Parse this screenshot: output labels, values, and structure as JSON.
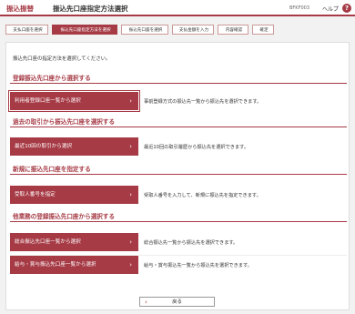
{
  "header": {
    "category": "振込振替",
    "title": "振込先口座指定方法選択",
    "screen_code": "BFKF003",
    "help_label": "ヘルプ",
    "help_icon": "?"
  },
  "steps": [
    "支払口座を選択",
    "振込先口座指定方法を選択",
    "振込先口座を選択",
    "支払金額を入力",
    "内容確認",
    "確定"
  ],
  "intro": "振込先口座の指定方法を選択してください。",
  "sections": [
    {
      "title": "登録振込先口座から選択する",
      "items": [
        {
          "label": "利用者登録口座一覧から選択",
          "desc": "事前登録方式の振込先一覧から振込先を選択できます。",
          "selected": true
        }
      ]
    },
    {
      "title": "過去の取引から振込先口座を選択する",
      "items": [
        {
          "label": "最近10回の取引から選択",
          "desc": "最近10回の取引履歴から振込先を選択できます。",
          "selected": false
        }
      ]
    },
    {
      "title": "新規に振込先口座を指定する",
      "items": [
        {
          "label": "受取人番号を指定",
          "desc": "受取人番号を入力して、新規に振込先を指定できます。",
          "selected": false
        }
      ]
    },
    {
      "title": "他業務の登録振込先口座から選択する",
      "items": [
        {
          "label": "総合振込先口座一覧から選択",
          "desc": "総合振込先一覧から振込先を選択できます。",
          "selected": false
        },
        {
          "label": "給与・賞与振込先口座一覧から選択",
          "desc": "給与・賞与振込先一覧から振込先を選択できます。",
          "selected": false
        }
      ]
    }
  ],
  "back_label": "戻る",
  "colors": {
    "accent": "#a63a45"
  }
}
